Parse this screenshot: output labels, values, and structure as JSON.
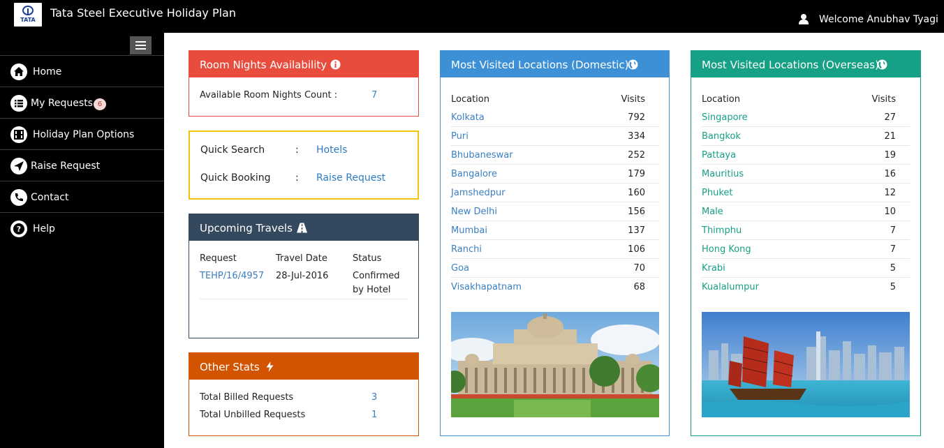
{
  "app": {
    "title": "Tata Steel Executive Holiday Plan",
    "logo_text": "TATA",
    "welcome": "Welcome Anubhav Tyagi"
  },
  "sidebar": {
    "items": [
      {
        "label": "Home",
        "icon": "home-icon"
      },
      {
        "label": "My Requests",
        "icon": "list-icon",
        "badge": "6"
      },
      {
        "label": "Holiday Plan Options",
        "icon": "film-icon"
      },
      {
        "label": "Raise Request",
        "icon": "send-icon"
      },
      {
        "label": "Contact",
        "icon": "phone-icon"
      },
      {
        "label": "Help",
        "icon": "question-icon"
      }
    ]
  },
  "room": {
    "title": "Room Nights Availability",
    "label": "Available Room Nights Count :",
    "value": "7"
  },
  "quick": {
    "search_label": "Quick Search",
    "search_colon": ":",
    "search_link": "Hotels",
    "booking_label": "Quick Booking",
    "booking_colon": ":",
    "booking_link": "Raise Request"
  },
  "upcoming": {
    "title": "Upcoming Travels",
    "headers": [
      "Request",
      "Travel Date",
      "Status"
    ],
    "rows": [
      {
        "request": "TEHP/16/4957",
        "date": "28-Jul-2016",
        "status_line1": "Confirmed",
        "status_line2": "by Hotel"
      }
    ]
  },
  "other": {
    "title": "Other Stats",
    "billed_label": "Total Billed Requests",
    "billed_value": "3",
    "unbilled_label": "Total Unbilled Requests",
    "unbilled_value": "1"
  },
  "domestic": {
    "title": "Most Visited Locations (Domestic)",
    "col_location": "Location",
    "col_visits": "Visits",
    "rows": [
      {
        "location": "Kolkata",
        "visits": "792"
      },
      {
        "location": "Puri",
        "visits": "334"
      },
      {
        "location": "Bhubaneswar",
        "visits": "252"
      },
      {
        "location": "Bangalore",
        "visits": "179"
      },
      {
        "location": "Jamshedpur",
        "visits": "160"
      },
      {
        "location": "New Delhi",
        "visits": "156"
      },
      {
        "location": "Mumbai",
        "visits": "137"
      },
      {
        "location": "Ranchi",
        "visits": "106"
      },
      {
        "location": "Goa",
        "visits": "70"
      },
      {
        "location": "Visakhapatnam",
        "visits": "68"
      }
    ]
  },
  "overseas": {
    "title": "Most Visited Locations (Overseas)",
    "col_location": "Location",
    "col_visits": "Visits",
    "rows": [
      {
        "location": "Singapore",
        "visits": "27"
      },
      {
        "location": "Bangkok",
        "visits": "21"
      },
      {
        "location": "Pattaya",
        "visits": "19"
      },
      {
        "location": "Mauritius",
        "visits": "16"
      },
      {
        "location": "Phuket",
        "visits": "12"
      },
      {
        "location": "Male",
        "visits": "10"
      },
      {
        "location": "Thimphu",
        "visits": "7"
      },
      {
        "location": "Hong Kong",
        "visits": "7"
      },
      {
        "location": "Krabi",
        "visits": "5"
      },
      {
        "location": "Kualalumpur",
        "visits": "5"
      }
    ]
  },
  "colors": {
    "room": "#e74c3c",
    "quick_border": "#f1c40f",
    "upcoming": "#34495e",
    "other": "#d35400",
    "domestic": "#3d8fd6",
    "overseas": "#16a085"
  }
}
